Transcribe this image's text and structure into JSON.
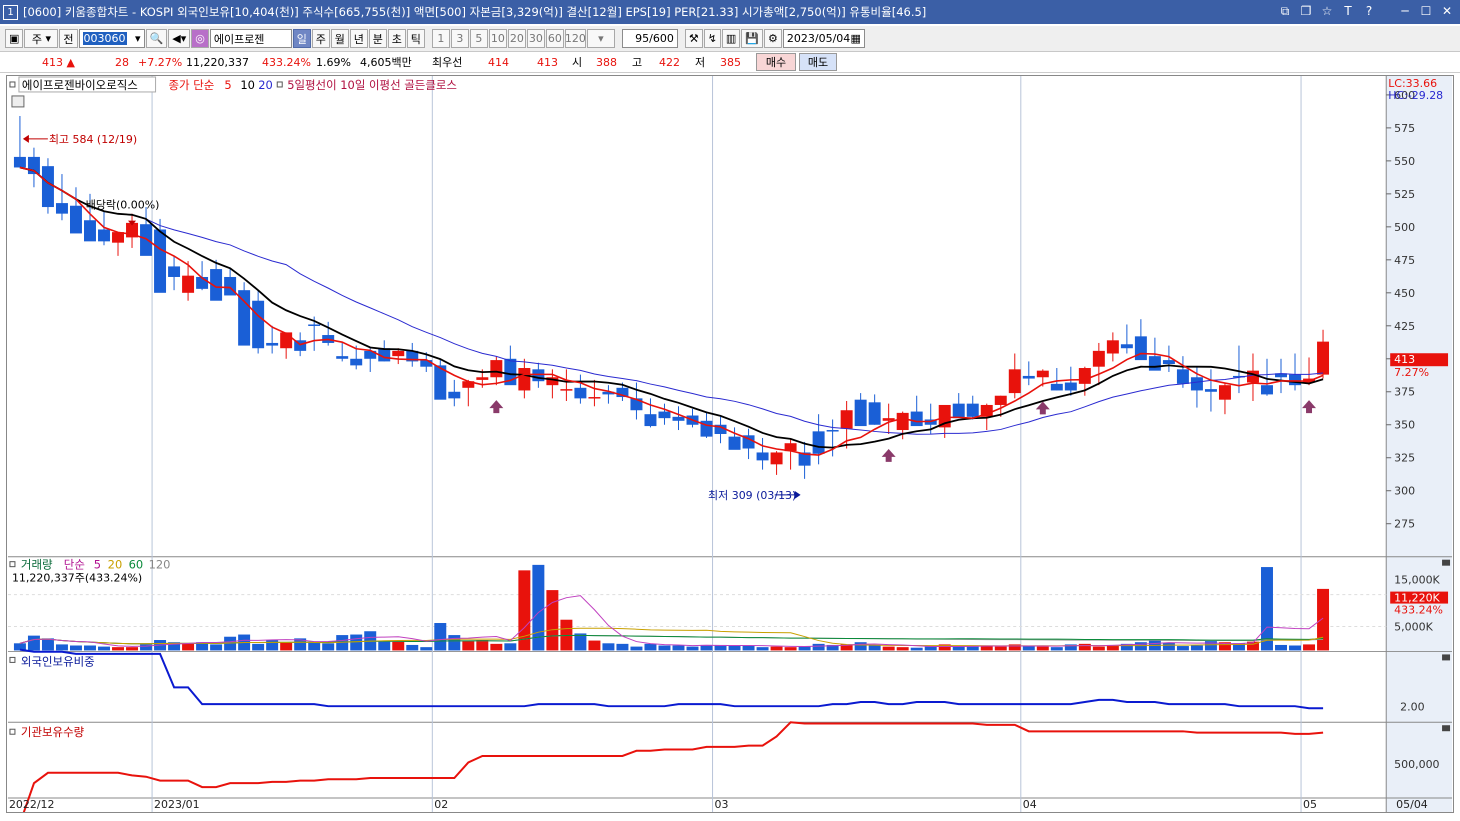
{
  "window": {
    "number": "1",
    "title": "[0600] 키움종합차트 - KOSPI 외국인보유[10,404(천)] 주식수[665,755(천)] 액면[500] 자본금[3,329(억)] 결산[12월] EPS[19] PER[21.33] 시가총액[2,750(억)] 유통비율[46.5]",
    "icons": [
      "restore-icon",
      "tile-icon",
      "star-icon",
      "text-icon",
      "help-icon",
      "minimize-icon",
      "maximize-icon",
      "close-icon"
    ]
  },
  "toolbar": {
    "period_type": "주",
    "market": "전",
    "code": "003060",
    "stock_name": "에이프로젠",
    "periods": [
      "일",
      "주",
      "월",
      "년",
      "분",
      "초",
      "틱"
    ],
    "active_period": "일",
    "intervals": [
      "1",
      "3",
      "5",
      "10",
      "20",
      "30",
      "60",
      "120"
    ],
    "count": "95/600",
    "date": "2023/05/04"
  },
  "quote": {
    "price": "413",
    "arrow": "▲",
    "change": "28",
    "change_pct": "+7.27%",
    "volume": "11,220,337",
    "volume_ratio": "433.24%",
    "turnover": "1.69%",
    "amount": "4,605백만",
    "best_label": "최우선",
    "best_ask": "414",
    "best_bid": "413",
    "open_label": "시",
    "open": "388",
    "high_label": "고",
    "high": "422",
    "low_label": "저",
    "low": "385",
    "buy_label": "매수",
    "sell_label": "매도"
  },
  "legend": {
    "stock": "에이프로젠바이오로직스",
    "ma_label": "종가 단순",
    "ma_periods": [
      "5",
      "10",
      "20"
    ],
    "signal": "5일평선이 10일 이평선 골든클로스",
    "lc": "LC:33.66",
    "hc": "HC:-29.28"
  },
  "annotations": {
    "high": "최고 584 (12/19)",
    "low": "최저 309 (03/13)",
    "dividend": "배당락(0.00%)",
    "price_tag": "413",
    "pct_tag": "7.27%"
  },
  "volume_panel": {
    "title": "거래량",
    "ma_label": "단순",
    "ma_periods": [
      "5",
      "20",
      "60",
      "120"
    ],
    "current": "11,220,337주(433.24%)",
    "tag_value": "11,220K",
    "tag_pct": "433.24%",
    "axis": [
      "15,000K",
      "5,000K"
    ]
  },
  "foreign_panel": {
    "title": "외국인보유비중",
    "axis": "2.00"
  },
  "inst_panel": {
    "title": "기관보유수량",
    "axis": "500,000"
  },
  "price_axis": [
    "600",
    "575",
    "550",
    "525",
    "500",
    "475",
    "450",
    "425",
    "400",
    "375",
    "350",
    "325",
    "300",
    "275"
  ],
  "date_axis": [
    "2022/12",
    "2023/01",
    "02",
    "03",
    "04",
    "05",
    "05/04"
  ],
  "colors": {
    "up": "#e8120c",
    "down": "#1a5fd6",
    "ma5": "#e8120c",
    "ma10": "#000000",
    "ma20": "#2a2ad0",
    "title": "#3b5fa6"
  },
  "chart_data": {
    "type": "candlestick",
    "x": [
      "12/19",
      "12/20",
      "12/21",
      "12/22",
      "12/23",
      "12/26",
      "12/27",
      "12/28",
      "12/29",
      "01/02",
      "01/03",
      "01/04",
      "01/05",
      "01/06",
      "01/09",
      "01/10",
      "01/11",
      "01/12",
      "01/13",
      "01/16",
      "01/17",
      "01/18",
      "01/19",
      "01/20",
      "01/25",
      "01/26",
      "01/27",
      "01/30",
      "01/31",
      "02/01",
      "02/02",
      "02/03",
      "02/06",
      "02/07",
      "02/08",
      "02/09",
      "02/10",
      "02/13",
      "02/14",
      "02/15",
      "02/16",
      "02/17",
      "02/20",
      "02/21",
      "02/22",
      "02/23",
      "02/24",
      "02/27",
      "02/28",
      "03/02",
      "03/03",
      "03/06",
      "03/07",
      "03/08",
      "03/09",
      "03/10",
      "03/13",
      "03/14",
      "03/15",
      "03/16",
      "03/17",
      "03/20",
      "03/21",
      "03/22",
      "03/23",
      "03/24",
      "03/27",
      "03/28",
      "03/29",
      "03/30",
      "03/31",
      "04/03",
      "04/04",
      "04/05",
      "04/06",
      "04/07",
      "04/10",
      "04/11",
      "04/12",
      "04/13",
      "04/14",
      "04/17",
      "04/18",
      "04/19",
      "04/20",
      "04/21",
      "04/24",
      "04/25",
      "04/26",
      "04/27",
      "04/28",
      "05/02",
      "05/03",
      "05/04"
    ],
    "open": [
      553,
      553,
      546,
      518,
      516,
      505,
      498,
      488,
      492,
      502,
      498,
      470,
      450,
      462,
      468,
      462,
      452,
      444,
      412,
      408,
      414,
      426,
      418,
      402,
      400,
      406,
      408,
      402,
      406,
      399,
      395,
      375,
      378,
      384,
      386,
      400,
      376,
      392,
      380,
      376,
      378,
      370,
      375,
      378,
      370,
      358,
      360,
      356,
      357,
      353,
      350,
      341,
      342,
      329,
      320,
      330,
      329,
      345,
      346,
      347,
      369,
      367,
      353,
      346,
      360,
      354,
      348,
      366,
      366,
      356,
      365,
      374,
      387,
      386,
      381,
      382,
      381,
      394,
      404,
      411,
      417,
      402,
      399,
      392,
      386,
      377,
      369,
      387,
      382,
      380,
      389,
      388,
      382,
      388
    ],
    "high": [
      584,
      560,
      552,
      540,
      530,
      525,
      512,
      496,
      510,
      515,
      506,
      478,
      474,
      474,
      475,
      468,
      458,
      452,
      425,
      420,
      420,
      432,
      428,
      412,
      410,
      408,
      414,
      408,
      412,
      405,
      400,
      384,
      384,
      392,
      402,
      410,
      400,
      397,
      392,
      392,
      388,
      384,
      380,
      382,
      382,
      370,
      366,
      364,
      362,
      360,
      356,
      348,
      347,
      340,
      330,
      339,
      337,
      358,
      354,
      368,
      374,
      373,
      366,
      360,
      372,
      366,
      360,
      374,
      372,
      366,
      372,
      404,
      398,
      392,
      393,
      394,
      394,
      412,
      420,
      426,
      430,
      416,
      410,
      402,
      394,
      392,
      382,
      410,
      404,
      400,
      400,
      404,
      401,
      422
    ],
    "low": [
      545,
      530,
      510,
      505,
      498,
      490,
      486,
      478,
      484,
      486,
      474,
      452,
      444,
      452,
      456,
      450,
      440,
      404,
      404,
      400,
      402,
      406,
      410,
      398,
      392,
      390,
      398,
      396,
      394,
      390,
      370,
      364,
      364,
      378,
      380,
      382,
      370,
      378,
      370,
      368,
      366,
      364,
      366,
      368,
      354,
      348,
      350,
      346,
      348,
      340,
      336,
      332,
      324,
      316,
      312,
      316,
      309,
      320,
      326,
      332,
      360,
      350,
      343,
      339,
      350,
      343,
      340,
      356,
      354,
      346,
      356,
      370,
      380,
      379,
      376,
      372,
      372,
      380,
      398,
      404,
      402,
      392,
      390,
      378,
      363,
      360,
      358,
      374,
      368,
      372,
      374,
      376,
      380,
      385
    ],
    "close": [
      545,
      540,
      515,
      510,
      495,
      489,
      489,
      496,
      503,
      478,
      450,
      462,
      463,
      453,
      444,
      448,
      410,
      408,
      410,
      420,
      406,
      425,
      412,
      400,
      395,
      400,
      398,
      406,
      398,
      394,
      369,
      370,
      383,
      386,
      399,
      380,
      393,
      383,
      386,
      377,
      370,
      371,
      373,
      371,
      361,
      349,
      355,
      353,
      350,
      341,
      343,
      331,
      332,
      323,
      329,
      336,
      319,
      328,
      345,
      361,
      349,
      350,
      355,
      359,
      349,
      350,
      365,
      355,
      356,
      365,
      372,
      392,
      385,
      391,
      376,
      376,
      393,
      406,
      414,
      408,
      399,
      391,
      396,
      381,
      376,
      375,
      380,
      386,
      391,
      373,
      386,
      380,
      385,
      413
    ],
    "ma_notes": "5일 이평선(빨강), 10일 이평선(검정), 20일 이평선(파랑)",
    "volume_k": [
      1300,
      2700,
      2200,
      1100,
      900,
      900,
      700,
      600,
      600,
      1100,
      1900,
      1500,
      1300,
      1500,
      1100,
      2500,
      2900,
      1200,
      1900,
      1400,
      2200,
      1400,
      1300,
      2800,
      2900,
      3500,
      1700,
      1600,
      1000,
      600,
      5000,
      2800,
      1800,
      1900,
      1200,
      1300,
      14600,
      15600,
      11000,
      5600,
      3100,
      1800,
      1300,
      1200,
      700,
      1200,
      900,
      900,
      700,
      1000,
      1000,
      900,
      900,
      600,
      700,
      600,
      800,
      1200,
      1000,
      1100,
      1500,
      1000,
      700,
      600,
      500,
      700,
      1100,
      700,
      700,
      800,
      700,
      1100,
      800,
      700,
      600,
      1100,
      1200,
      700,
      1000,
      1200,
      1500,
      2000,
      1400,
      800,
      900,
      1700,
      1500,
      1300,
      1600,
      15200,
      1000,
      900,
      1100,
      11220
    ],
    "foreign_pct": [
      2.28,
      2.27,
      2.27,
      2.27,
      2.26,
      2.26,
      2.26,
      2.26,
      2.26,
      2.26,
      2.26,
      2.1,
      2.1,
      2.02,
      2.02,
      2.02,
      2.02,
      2.02,
      2.02,
      2.02,
      2.02,
      2.02,
      2.01,
      2.01,
      2.01,
      2.01,
      2.01,
      2.01,
      2.01,
      2.01,
      2.01,
      2.01,
      2.01,
      2.01,
      2.01,
      2.01,
      2.01,
      2.02,
      2.02,
      2.02,
      2.02,
      2.02,
      2.01,
      2.01,
      2.01,
      2.01,
      2.01,
      2.02,
      2.02,
      2.02,
      2.02,
      2.01,
      2.01,
      2.01,
      2.01,
      2.01,
      2.01,
      2.01,
      2.02,
      2.02,
      2.03,
      2.03,
      2.02,
      2.02,
      2.03,
      2.03,
      2.03,
      2.02,
      2.02,
      2.02,
      2.02,
      2.02,
      2.02,
      2.02,
      2.02,
      2.02,
      2.03,
      2.04,
      2.04,
      2.03,
      2.03,
      2.03,
      2.02,
      2.02,
      2.02,
      2.02,
      2.02,
      2.01,
      2.01,
      2.01,
      2.01,
      2.01,
      2.0,
      2.0
    ],
    "inst_qty": [
      120000,
      430000,
      510000,
      510000,
      510000,
      510000,
      510000,
      510000,
      490000,
      480000,
      450000,
      450000,
      450000,
      400000,
      400000,
      430000,
      430000,
      430000,
      440000,
      440000,
      450000,
      450000,
      460000,
      460000,
      460000,
      470000,
      470000,
      470000,
      470000,
      470000,
      470000,
      470000,
      590000,
      640000,
      640000,
      640000,
      640000,
      640000,
      640000,
      640000,
      640000,
      640000,
      640000,
      640000,
      680000,
      680000,
      690000,
      690000,
      690000,
      710000,
      710000,
      710000,
      720000,
      720000,
      790000,
      900000,
      890000,
      890000,
      890000,
      890000,
      890000,
      890000,
      890000,
      890000,
      890000,
      890000,
      890000,
      890000,
      890000,
      880000,
      880000,
      880000,
      830000,
      830000,
      830000,
      830000,
      830000,
      830000,
      830000,
      830000,
      830000,
      830000,
      830000,
      830000,
      820000,
      820000,
      820000,
      820000,
      820000,
      820000,
      820000,
      810000,
      810000,
      820000
    ]
  }
}
